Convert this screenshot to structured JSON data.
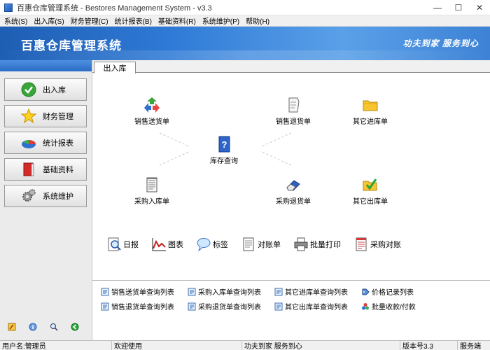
{
  "window": {
    "title": "百惠仓库管理系统 - Bestores Management System - v3.3",
    "minimize_icon": "—",
    "maximize_icon": "☐",
    "close_icon": "✕"
  },
  "menu": [
    "系统(S)",
    "出入库(S)",
    "财务管理(C)",
    "统计报表(B)",
    "基础资料(R)",
    "系统维护(P)",
    "帮助(H)"
  ],
  "banner": {
    "title": "百惠仓库管理系统",
    "slogan": "功夫到家  服务到心",
    "colors": {
      "start": "#1e5eb3",
      "end": "#5aa0e8"
    }
  },
  "sidebar": {
    "items": [
      {
        "label": "出入库",
        "icon": "check-circle-icon"
      },
      {
        "label": "财务管理",
        "icon": "star-icon"
      },
      {
        "label": "统计报表",
        "icon": "pie-chart-icon"
      },
      {
        "label": "基础资料",
        "icon": "book-icon"
      },
      {
        "label": "系统维护",
        "icon": "gears-icon"
      }
    ],
    "bottom_icons": [
      "edit-icon",
      "info-icon",
      "search-icon",
      "back-icon"
    ]
  },
  "tabs": [
    {
      "label": "出入库"
    }
  ],
  "diagram": {
    "sales_delivery": "销售送货单",
    "sales_return": "销售退货单",
    "other_in": "其它进库单",
    "stock_query": "库存查询",
    "purchase_in": "采购入库单",
    "purchase_return": "采购退货单",
    "other_out": "其它出库单"
  },
  "tools": [
    {
      "label": "日报",
      "icon": "magnifier-icon"
    },
    {
      "label": "图表",
      "icon": "line-chart-icon"
    },
    {
      "label": "标签",
      "icon": "speech-bubble-icon"
    },
    {
      "label": "对账单",
      "icon": "document-icon"
    },
    {
      "label": "批量打印",
      "icon": "printer-icon"
    },
    {
      "label": "采购对账",
      "icon": "report-icon"
    }
  ],
  "links": [
    {
      "label": "销售送货单查询列表",
      "icon": "list-icon"
    },
    {
      "label": "采购入库单查询列表",
      "icon": "list-icon"
    },
    {
      "label": "其它进库单查询列表",
      "icon": "list-icon"
    },
    {
      "label": "价格记录列表",
      "icon": "price-icon"
    },
    {
      "label": "销售退货单查询列表",
      "icon": "list-icon"
    },
    {
      "label": "采购退货单查询列表",
      "icon": "list-icon"
    },
    {
      "label": "其它出库单查询列表",
      "icon": "list-icon"
    },
    {
      "label": "批量收款/付款",
      "icon": "balls-icon"
    }
  ],
  "status": {
    "user": "用户名:管理员",
    "welcome": "欢迎使用",
    "slogan": "功夫到家 服务到心",
    "version": "版本号3.3",
    "service": "服务端"
  }
}
